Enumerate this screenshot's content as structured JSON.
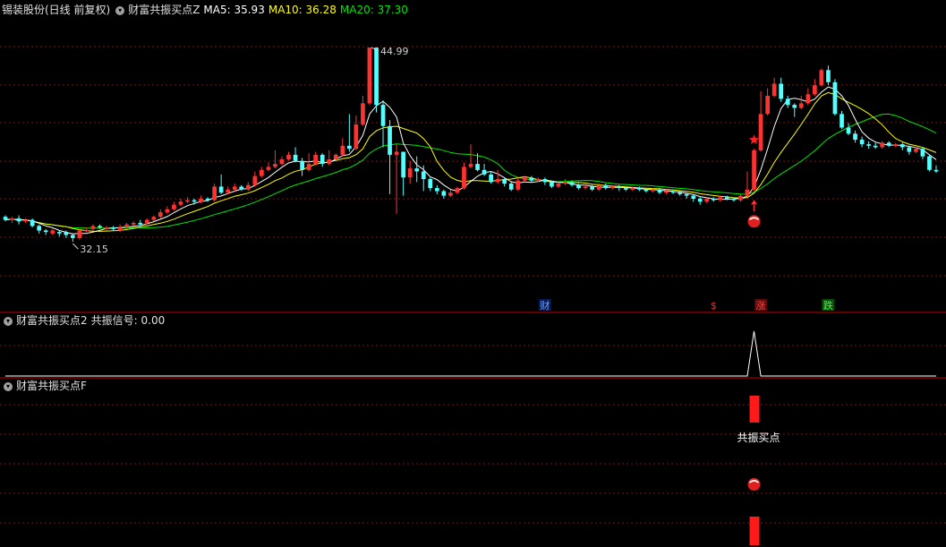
{
  "header": {
    "stock_title": "锡装股份(日线 前复权)",
    "indicator_name": "财富共振买点Z",
    "ma5_label": "MA5: 35.93",
    "ma10_label": "MA10: 36.28",
    "ma20_label": "MA20: 37.30"
  },
  "panel2": {
    "indicator_name": "财富共振买点2",
    "signal_label": "共振信号: 0.00"
  },
  "panel3": {
    "indicator_name": "财富共振买点F",
    "buy_text": "共振买点"
  },
  "colors": {
    "up": "#ff3232",
    "down": "#54ffff",
    "ma5": "#ffffff",
    "ma10": "#ffff00",
    "ma20": "#00e600",
    "grid": "#7a1010",
    "divider": "#c00000"
  },
  "chart_data": {
    "type": "candlestick",
    "ylim": [
      30.5,
      46.0
    ],
    "high_label": "44.99",
    "low_label": "32.15",
    "markers": [
      {
        "text": "财",
        "index": 80,
        "color": "#6aa0ff",
        "bg": "#0a1a50"
      },
      {
        "text": "$",
        "index": 105,
        "color": "#ff3030",
        "bg": "#000000"
      },
      {
        "text": "涨",
        "index": 112,
        "color": "#ff4040",
        "bg": "#5a0a0a"
      },
      {
        "text": "跌",
        "index": 122,
        "color": "#40ff40",
        "bg": "#0a4a0a"
      }
    ],
    "buy_signal_index": 111,
    "signal_peak": 1.0,
    "candles": [
      [
        33.8,
        33.6,
        33.9,
        33.5
      ],
      [
        33.6,
        33.7,
        33.8,
        33.4
      ],
      [
        33.7,
        33.5,
        33.9,
        33.3
      ],
      [
        33.5,
        33.6,
        33.7,
        33.4
      ],
      [
        33.6,
        33.2,
        33.7,
        33.1
      ],
      [
        33.2,
        32.9,
        33.3,
        32.7
      ],
      [
        32.9,
        32.8,
        33.0,
        32.6
      ],
      [
        32.7,
        32.9,
        33.0,
        32.6
      ],
      [
        32.8,
        32.7,
        32.9,
        32.5
      ],
      [
        32.8,
        32.6,
        32.9,
        32.4
      ],
      [
        32.6,
        32.4,
        32.7,
        32.15
      ],
      [
        32.4,
        32.9,
        33.0,
        32.3
      ],
      [
        32.9,
        32.9,
        33.1,
        32.8
      ],
      [
        33.0,
        33.2,
        33.3,
        32.9
      ],
      [
        33.2,
        33.1,
        33.3,
        33.0
      ],
      [
        33.0,
        33.1,
        33.2,
        32.9
      ],
      [
        33.1,
        33.0,
        33.2,
        32.9
      ],
      [
        32.9,
        33.1,
        33.3,
        32.8
      ],
      [
        33.1,
        33.3,
        33.4,
        33.0
      ],
      [
        33.3,
        33.4,
        33.5,
        33.2
      ],
      [
        33.4,
        33.3,
        33.6,
        33.2
      ],
      [
        33.4,
        33.6,
        33.7,
        33.3
      ],
      [
        33.6,
        33.8,
        33.9,
        33.5
      ],
      [
        33.8,
        34.1,
        34.3,
        33.7
      ],
      [
        34.1,
        34.3,
        34.5,
        34.0
      ],
      [
        34.3,
        34.6,
        34.8,
        34.2
      ],
      [
        34.6,
        34.8,
        35.0,
        34.5
      ],
      [
        34.8,
        34.9,
        35.1,
        34.7
      ],
      [
        34.9,
        34.8,
        35.0,
        34.6
      ],
      [
        34.8,
        35.0,
        35.2,
        34.7
      ],
      [
        35.0,
        34.9,
        35.1,
        34.8
      ],
      [
        34.9,
        35.8,
        36.0,
        34.8
      ],
      [
        35.8,
        35.4,
        36.6,
        35.3
      ],
      [
        35.4,
        35.6,
        35.8,
        35.3
      ],
      [
        35.6,
        35.8,
        36.0,
        35.5
      ],
      [
        35.8,
        35.6,
        35.9,
        35.5
      ],
      [
        35.6,
        35.9,
        36.1,
        35.5
      ],
      [
        35.9,
        36.5,
        36.8,
        35.8
      ],
      [
        36.5,
        36.9,
        37.1,
        36.4
      ],
      [
        36.9,
        37.1,
        37.4,
        36.8
      ],
      [
        37.1,
        37.3,
        38.2,
        37.0
      ],
      [
        37.3,
        37.6,
        37.8,
        37.2
      ],
      [
        37.6,
        37.9,
        38.1,
        37.5
      ],
      [
        37.9,
        37.5,
        38.4,
        37.4
      ],
      [
        37.5,
        36.9,
        37.7,
        36.5
      ],
      [
        36.9,
        37.3,
        38.0,
        36.8
      ],
      [
        37.3,
        37.9,
        38.1,
        37.2
      ],
      [
        37.9,
        37.3,
        38.0,
        37.1
      ],
      [
        37.3,
        37.6,
        38.2,
        37.2
      ],
      [
        37.6,
        37.9,
        38.0,
        37.5
      ],
      [
        37.9,
        38.5,
        39.0,
        37.8
      ],
      [
        38.5,
        38.3,
        40.6,
        38.1
      ],
      [
        38.3,
        39.9,
        40.5,
        38.2
      ],
      [
        39.9,
        41.3,
        41.8,
        39.8
      ],
      [
        41.3,
        44.99,
        44.99,
        41.2
      ],
      [
        44.99,
        41.2,
        43.2,
        40.7
      ],
      [
        41.2,
        39.8,
        41.5,
        38.4
      ],
      [
        39.8,
        37.9,
        40.2,
        35.3
      ],
      [
        37.9,
        38.1,
        38.6,
        34.0
      ],
      [
        38.1,
        36.4,
        36.6,
        35.2
      ],
      [
        36.4,
        37.0,
        37.5,
        36.0
      ],
      [
        37.0,
        36.8,
        37.8,
        36.1
      ],
      [
        36.8,
        36.3,
        37.2,
        35.5
      ],
      [
        36.3,
        35.7,
        36.4,
        35.5
      ],
      [
        35.7,
        35.5,
        35.9,
        35.3
      ],
      [
        35.5,
        35.2,
        35.6,
        35.0
      ],
      [
        35.2,
        35.4,
        35.6,
        35.1
      ],
      [
        35.4,
        35.7,
        35.8,
        35.3
      ],
      [
        35.7,
        37.1,
        37.4,
        35.6
      ],
      [
        37.1,
        37.3,
        38.6,
        37.0
      ],
      [
        37.3,
        36.9,
        38.0,
        36.8
      ],
      [
        36.9,
        36.6,
        37.3,
        36.5
      ],
      [
        36.6,
        36.1,
        36.8,
        36.0
      ],
      [
        36.1,
        36.3,
        36.9,
        36.0
      ],
      [
        36.3,
        36.0,
        36.4,
        35.8
      ],
      [
        36.0,
        35.6,
        36.1,
        35.5
      ],
      [
        35.6,
        36.2,
        36.4,
        35.5
      ],
      [
        36.2,
        36.4,
        36.5,
        36.1
      ],
      [
        36.4,
        36.2,
        36.5,
        36.1
      ],
      [
        36.2,
        36.3,
        36.4,
        36.1
      ],
      [
        36.3,
        36.1,
        36.4,
        35.9
      ],
      [
        36.1,
        35.8,
        36.2,
        35.7
      ],
      [
        35.8,
        36.0,
        36.1,
        35.7
      ],
      [
        36.0,
        36.1,
        36.3,
        35.9
      ],
      [
        36.1,
        35.9,
        36.2,
        35.8
      ],
      [
        35.9,
        35.7,
        36.0,
        35.6
      ],
      [
        35.7,
        35.8,
        35.9,
        35.6
      ],
      [
        35.8,
        35.6,
        35.9,
        35.5
      ],
      [
        35.6,
        35.9,
        36.0,
        35.5
      ],
      [
        35.9,
        35.7,
        36.0,
        35.6
      ],
      [
        35.7,
        35.8,
        35.9,
        35.6
      ],
      [
        35.8,
        35.7,
        35.9,
        35.5
      ],
      [
        35.7,
        35.6,
        35.8,
        35.5
      ],
      [
        35.6,
        35.7,
        35.8,
        35.5
      ],
      [
        35.7,
        35.6,
        35.8,
        35.5
      ],
      [
        35.6,
        35.5,
        35.7,
        35.4
      ],
      [
        35.5,
        35.6,
        35.7,
        35.4
      ],
      [
        35.6,
        35.4,
        35.7,
        35.3
      ],
      [
        35.4,
        35.5,
        35.6,
        35.3
      ],
      [
        35.5,
        35.4,
        35.6,
        35.3
      ],
      [
        35.4,
        35.3,
        35.5,
        35.2
      ],
      [
        35.3,
        35.2,
        35.4,
        35.0
      ],
      [
        35.2,
        35.0,
        35.3,
        34.8
      ],
      [
        35.0,
        34.8,
        35.1,
        34.6
      ],
      [
        34.8,
        35.0,
        35.1,
        34.7
      ],
      [
        35.0,
        34.9,
        35.1,
        34.8
      ],
      [
        34.9,
        35.1,
        35.2,
        34.8
      ],
      [
        35.1,
        35.0,
        35.2,
        34.9
      ],
      [
        35.0,
        34.9,
        35.1,
        34.8
      ],
      [
        34.9,
        35.2,
        35.3,
        34.8
      ],
      [
        35.2,
        35.6,
        36.8,
        35.1
      ],
      [
        35.6,
        38.2,
        38.3,
        35.5
      ],
      [
        38.2,
        40.6,
        42.1,
        38.1
      ],
      [
        40.6,
        41.8,
        42.3,
        40.5
      ],
      [
        41.8,
        42.6,
        43.0,
        41.7
      ],
      [
        42.6,
        41.6,
        43.0,
        41.4
      ],
      [
        41.6,
        41.2,
        41.8,
        41.0
      ],
      [
        41.2,
        41.0,
        41.3,
        40.4
      ],
      [
        41.0,
        41.3,
        41.8,
        40.9
      ],
      [
        41.3,
        41.9,
        42.3,
        41.2
      ],
      [
        41.9,
        42.5,
        42.9,
        41.8
      ],
      [
        42.5,
        43.5,
        43.6,
        42.4
      ],
      [
        43.5,
        42.7,
        43.8,
        42.5
      ],
      [
        42.7,
        40.6,
        42.9,
        40.5
      ],
      [
        40.6,
        39.7,
        40.8,
        39.6
      ],
      [
        39.7,
        39.3,
        40.0,
        39.2
      ],
      [
        39.3,
        38.9,
        39.5,
        38.7
      ],
      [
        38.9,
        38.6,
        39.1,
        38.4
      ],
      [
        38.6,
        38.5,
        38.8,
        38.3
      ],
      [
        38.5,
        38.4,
        38.7,
        38.3
      ],
      [
        38.4,
        38.7,
        38.8,
        38.3
      ],
      [
        38.7,
        38.5,
        38.8,
        38.4
      ],
      [
        38.5,
        38.6,
        38.7,
        38.4
      ],
      [
        38.6,
        38.4,
        38.7,
        38.2
      ],
      [
        38.4,
        38.1,
        38.5,
        37.9
      ],
      [
        38.1,
        38.3,
        38.4,
        38.0
      ],
      [
        38.3,
        37.8,
        38.4,
        37.6
      ],
      [
        37.8,
        36.9,
        37.9,
        36.8
      ],
      [
        36.9,
        36.8,
        37.2,
        36.7
      ]
    ]
  }
}
